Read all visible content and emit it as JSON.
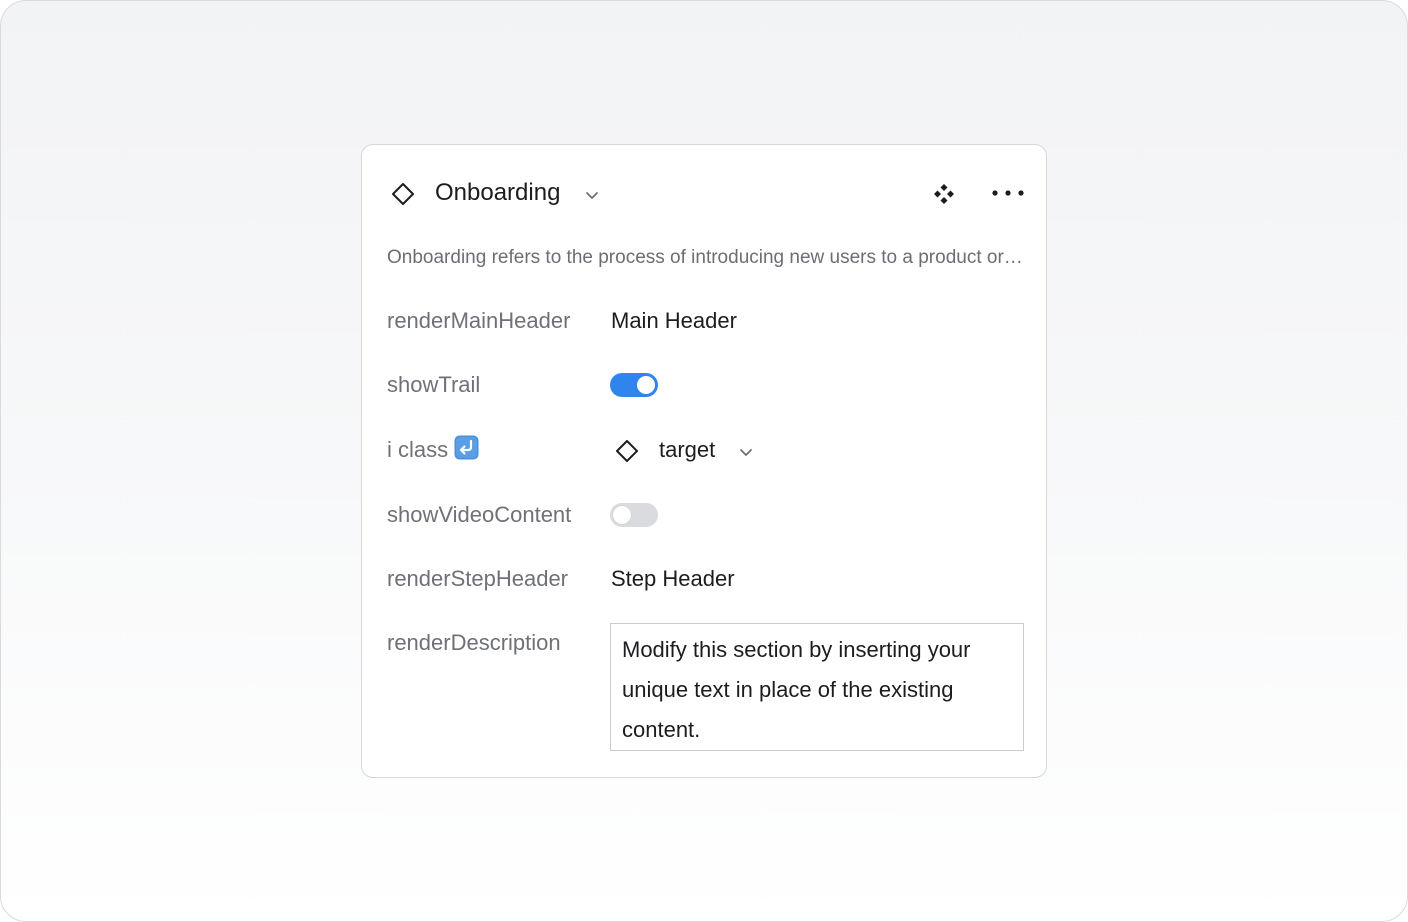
{
  "panel": {
    "title": "Onboarding",
    "description": "Onboarding refers to the process of introducing new users to a product or service."
  },
  "props": {
    "render_main_header": {
      "label": "renderMainHeader",
      "value": "Main Header"
    },
    "show_trail": {
      "label": "showTrail",
      "enabled": true
    },
    "i_class": {
      "label": "i class",
      "value": "target"
    },
    "show_video_content": {
      "label": "showVideoContent",
      "enabled": false
    },
    "render_step_header": {
      "label": "renderStepHeader",
      "value": "Step Header"
    },
    "render_description": {
      "label": "renderDescription",
      "value": "Modify this section by inserting your unique text in place of the existing content."
    }
  },
  "icons": {
    "title": "component-instance-icon",
    "title_chevron": "chevron-down-icon",
    "component": "component-icon",
    "more": "more-horizontal-icon",
    "i_class_swap": "return-arrow-icon",
    "target": "component-instance-icon",
    "target_chevron": "chevron-down-icon"
  },
  "colors": {
    "accent": "#2f84ee",
    "toggle_off": "#d9dbde",
    "label": "#6e7178",
    "text": "#1c1d20"
  }
}
